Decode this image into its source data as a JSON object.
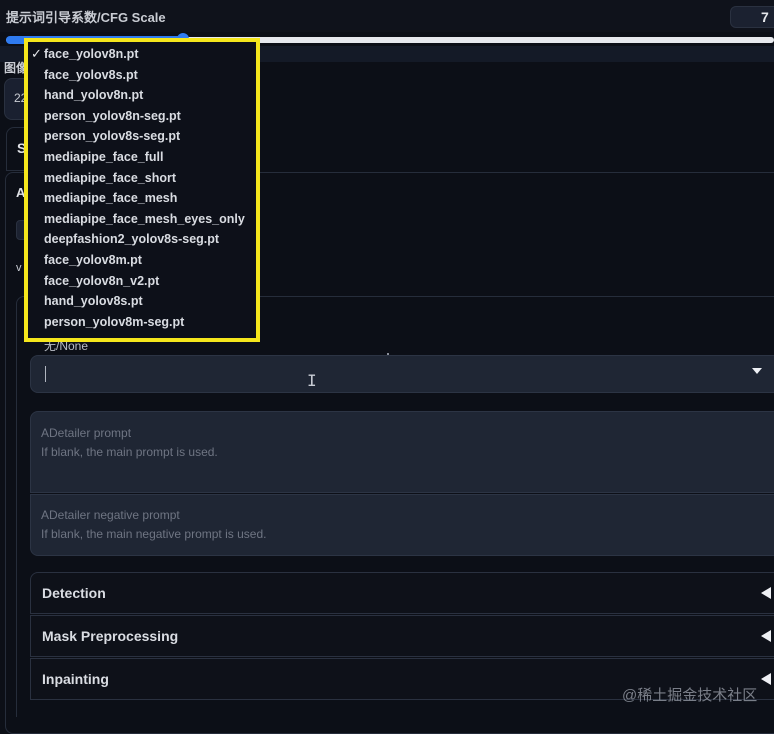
{
  "cfg": {
    "label": "提示词引导系数/CFG Scale",
    "value": "7",
    "slider_fraction": 0.23
  },
  "image_section": {
    "label_partial": "图像",
    "value_partial": "22"
  },
  "tab": {
    "letter": "S"
  },
  "adetailer": {
    "section_letter": "A",
    "version_letter": "v",
    "model_label": "无/None",
    "model_input_value": "",
    "prompt": {
      "title": "ADetailer prompt",
      "placeholder": "If blank, the main prompt is used."
    },
    "negative_prompt": {
      "title": "ADetailer negative prompt",
      "placeholder": "If blank, the main negative prompt is used."
    },
    "accordions": [
      {
        "label": "Detection"
      },
      {
        "label": "Mask Preprocessing"
      },
      {
        "label": "Inpainting"
      }
    ]
  },
  "dropdown": {
    "selected_index": 0,
    "check_glyph": "✓",
    "highlight_color": "#f5e61c",
    "options": [
      "face_yolov8n.pt",
      "face_yolov8s.pt",
      "hand_yolov8n.pt",
      "person_yolov8n-seg.pt",
      "person_yolov8s-seg.pt",
      "mediapipe_face_full",
      "mediapipe_face_short",
      "mediapipe_face_mesh",
      "mediapipe_face_mesh_eyes_only",
      "deepfashion2_yolov8s-seg.pt",
      "face_yolov8m.pt",
      "face_yolov8n_v2.pt",
      "hand_yolov8s.pt",
      "person_yolov8m-seg.pt"
    ]
  },
  "colors": {
    "accent": "#2f7bf0",
    "background": "#0c0f17",
    "input_bg": "#1f2634"
  },
  "watermark": "@稀土掘金技术社区"
}
